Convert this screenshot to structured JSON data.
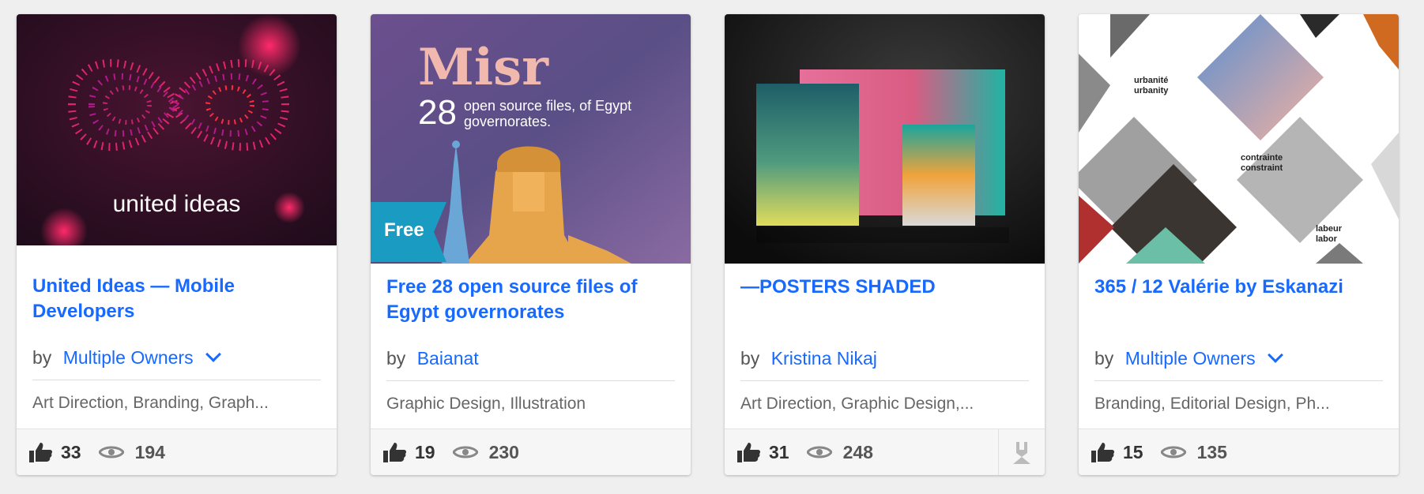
{
  "projects": [
    {
      "cover_text": "united ideas",
      "title": "United Ideas — Mobile Developers",
      "by": "by",
      "owner": "Multiple Owners",
      "fields": "Art Direction, Branding, Graph...",
      "likes": "33",
      "views": "194"
    },
    {
      "cover_text": {
        "heading": "Misr",
        "number": "28",
        "line1": "open source files, of Egypt",
        "line2": "governorates.",
        "badge": "Free"
      },
      "title": "Free 28 open source files of Egypt governorates",
      "by": "by",
      "owner": "Baianat",
      "fields": "Graphic Design, Illustration",
      "likes": "19",
      "views": "230"
    },
    {
      "title": "—POSTERS SHADED",
      "by": "by",
      "owner": "Kristina Nikaj",
      "fields": "Art Direction, Graphic Design,...",
      "likes": "31",
      "views": "248"
    },
    {
      "cover_text": {
        "row1": "urbanité urbanity",
        "row2": "contrainte constraint",
        "row3": "labeur labor"
      },
      "title": "365 / 12 Valérie by Eskanazi",
      "by": "by",
      "owner": "Multiple Owners",
      "fields": "Branding, Editorial Design, Ph...",
      "likes": "15",
      "views": "135"
    }
  ],
  "icons": {
    "like": "thumbs-up-icon",
    "views": "eye-icon",
    "featured": "featured-ribbon-icon",
    "dropdown": "chevron-down-icon"
  },
  "colors": {
    "link": "#1769ff",
    "background": "#efefef",
    "footer": "#f6f6f6"
  }
}
